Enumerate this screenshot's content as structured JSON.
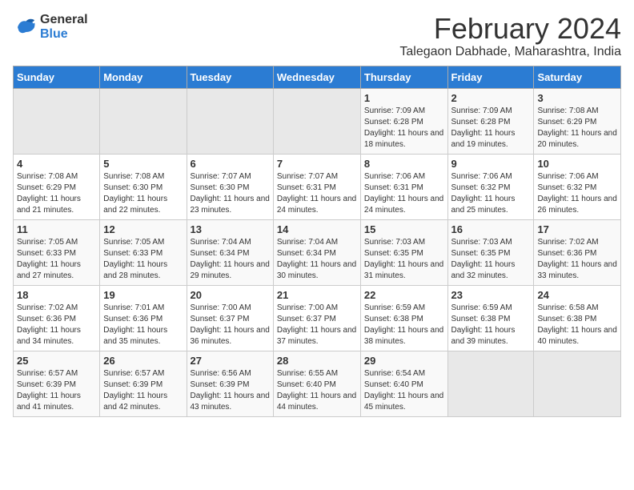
{
  "app": {
    "logo_line1": "General",
    "logo_line2": "Blue"
  },
  "header": {
    "title": "February 2024",
    "subtitle": "Talegaon Dabhade, Maharashtra, India"
  },
  "calendar": {
    "days_of_week": [
      "Sunday",
      "Monday",
      "Tuesday",
      "Wednesday",
      "Thursday",
      "Friday",
      "Saturday"
    ],
    "weeks": [
      [
        {
          "day": "",
          "sunrise": "",
          "sunset": "",
          "daylight": "",
          "empty": true
        },
        {
          "day": "",
          "sunrise": "",
          "sunset": "",
          "daylight": "",
          "empty": true
        },
        {
          "day": "",
          "sunrise": "",
          "sunset": "",
          "daylight": "",
          "empty": true
        },
        {
          "day": "",
          "sunrise": "",
          "sunset": "",
          "daylight": "",
          "empty": true
        },
        {
          "day": "1",
          "sunrise": "7:09 AM",
          "sunset": "6:28 PM",
          "daylight": "11 hours and 18 minutes.",
          "empty": false
        },
        {
          "day": "2",
          "sunrise": "7:09 AM",
          "sunset": "6:28 PM",
          "daylight": "11 hours and 19 minutes.",
          "empty": false
        },
        {
          "day": "3",
          "sunrise": "7:08 AM",
          "sunset": "6:29 PM",
          "daylight": "11 hours and 20 minutes.",
          "empty": false
        }
      ],
      [
        {
          "day": "4",
          "sunrise": "7:08 AM",
          "sunset": "6:29 PM",
          "daylight": "11 hours and 21 minutes.",
          "empty": false
        },
        {
          "day": "5",
          "sunrise": "7:08 AM",
          "sunset": "6:30 PM",
          "daylight": "11 hours and 22 minutes.",
          "empty": false
        },
        {
          "day": "6",
          "sunrise": "7:07 AM",
          "sunset": "6:30 PM",
          "daylight": "11 hours and 23 minutes.",
          "empty": false
        },
        {
          "day": "7",
          "sunrise": "7:07 AM",
          "sunset": "6:31 PM",
          "daylight": "11 hours and 24 minutes.",
          "empty": false
        },
        {
          "day": "8",
          "sunrise": "7:06 AM",
          "sunset": "6:31 PM",
          "daylight": "11 hours and 24 minutes.",
          "empty": false
        },
        {
          "day": "9",
          "sunrise": "7:06 AM",
          "sunset": "6:32 PM",
          "daylight": "11 hours and 25 minutes.",
          "empty": false
        },
        {
          "day": "10",
          "sunrise": "7:06 AM",
          "sunset": "6:32 PM",
          "daylight": "11 hours and 26 minutes.",
          "empty": false
        }
      ],
      [
        {
          "day": "11",
          "sunrise": "7:05 AM",
          "sunset": "6:33 PM",
          "daylight": "11 hours and 27 minutes.",
          "empty": false
        },
        {
          "day": "12",
          "sunrise": "7:05 AM",
          "sunset": "6:33 PM",
          "daylight": "11 hours and 28 minutes.",
          "empty": false
        },
        {
          "day": "13",
          "sunrise": "7:04 AM",
          "sunset": "6:34 PM",
          "daylight": "11 hours and 29 minutes.",
          "empty": false
        },
        {
          "day": "14",
          "sunrise": "7:04 AM",
          "sunset": "6:34 PM",
          "daylight": "11 hours and 30 minutes.",
          "empty": false
        },
        {
          "day": "15",
          "sunrise": "7:03 AM",
          "sunset": "6:35 PM",
          "daylight": "11 hours and 31 minutes.",
          "empty": false
        },
        {
          "day": "16",
          "sunrise": "7:03 AM",
          "sunset": "6:35 PM",
          "daylight": "11 hours and 32 minutes.",
          "empty": false
        },
        {
          "day": "17",
          "sunrise": "7:02 AM",
          "sunset": "6:36 PM",
          "daylight": "11 hours and 33 minutes.",
          "empty": false
        }
      ],
      [
        {
          "day": "18",
          "sunrise": "7:02 AM",
          "sunset": "6:36 PM",
          "daylight": "11 hours and 34 minutes.",
          "empty": false
        },
        {
          "day": "19",
          "sunrise": "7:01 AM",
          "sunset": "6:36 PM",
          "daylight": "11 hours and 35 minutes.",
          "empty": false
        },
        {
          "day": "20",
          "sunrise": "7:00 AM",
          "sunset": "6:37 PM",
          "daylight": "11 hours and 36 minutes.",
          "empty": false
        },
        {
          "day": "21",
          "sunrise": "7:00 AM",
          "sunset": "6:37 PM",
          "daylight": "11 hours and 37 minutes.",
          "empty": false
        },
        {
          "day": "22",
          "sunrise": "6:59 AM",
          "sunset": "6:38 PM",
          "daylight": "11 hours and 38 minutes.",
          "empty": false
        },
        {
          "day": "23",
          "sunrise": "6:59 AM",
          "sunset": "6:38 PM",
          "daylight": "11 hours and 39 minutes.",
          "empty": false
        },
        {
          "day": "24",
          "sunrise": "6:58 AM",
          "sunset": "6:38 PM",
          "daylight": "11 hours and 40 minutes.",
          "empty": false
        }
      ],
      [
        {
          "day": "25",
          "sunrise": "6:57 AM",
          "sunset": "6:39 PM",
          "daylight": "11 hours and 41 minutes.",
          "empty": false
        },
        {
          "day": "26",
          "sunrise": "6:57 AM",
          "sunset": "6:39 PM",
          "daylight": "11 hours and 42 minutes.",
          "empty": false
        },
        {
          "day": "27",
          "sunrise": "6:56 AM",
          "sunset": "6:39 PM",
          "daylight": "11 hours and 43 minutes.",
          "empty": false
        },
        {
          "day": "28",
          "sunrise": "6:55 AM",
          "sunset": "6:40 PM",
          "daylight": "11 hours and 44 minutes.",
          "empty": false
        },
        {
          "day": "29",
          "sunrise": "6:54 AM",
          "sunset": "6:40 PM",
          "daylight": "11 hours and 45 minutes.",
          "empty": false
        },
        {
          "day": "",
          "sunrise": "",
          "sunset": "",
          "daylight": "",
          "empty": true
        },
        {
          "day": "",
          "sunrise": "",
          "sunset": "",
          "daylight": "",
          "empty": true
        }
      ]
    ]
  }
}
